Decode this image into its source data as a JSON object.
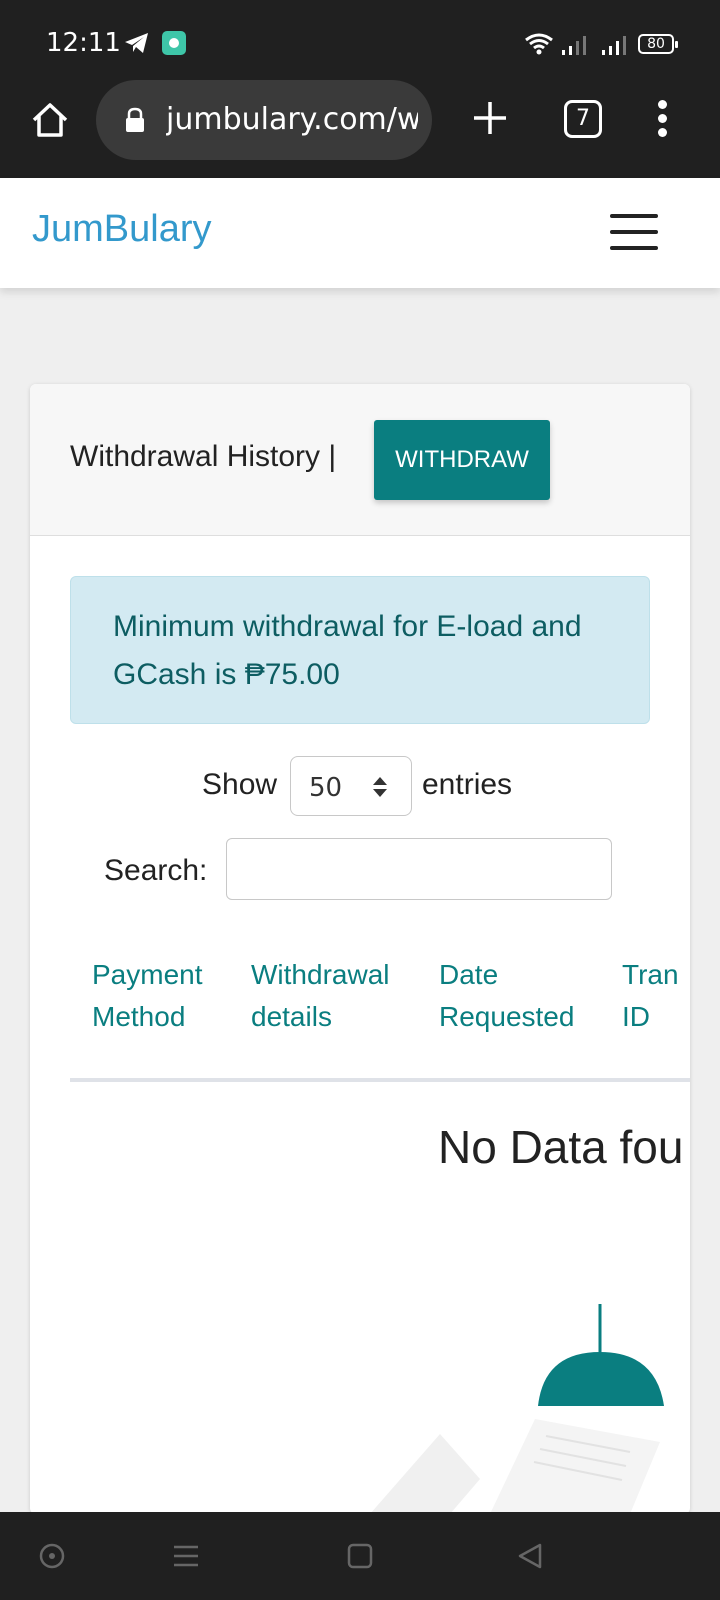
{
  "status_bar": {
    "time": "12:11",
    "battery": "80",
    "icons": [
      "telegram-icon",
      "app-notification-icon",
      "wifi-icon",
      "signal-icon",
      "signal-icon",
      "battery-icon"
    ]
  },
  "browser": {
    "url": "jumbulary.com/w",
    "tab_count": "7",
    "icons": [
      "home-icon",
      "lock-icon",
      "new-tab-icon",
      "more-icon"
    ]
  },
  "site": {
    "brand": "JumBulary",
    "menu_icon": "hamburger-icon"
  },
  "card": {
    "title": "Withdrawal History |",
    "withdraw_button": "WITHDRAW",
    "alert": "Minimum withdrawal for E-load and GCash is ₱75.00",
    "length": {
      "show_label": "Show",
      "selected": "50",
      "entries_label": "entries"
    },
    "search": {
      "label": "Search:",
      "value": "",
      "placeholder": ""
    },
    "table": {
      "headers": [
        "Payment\nMethod",
        "Withdrawal\ndetails",
        "Date\nRequested",
        "Tran\nID"
      ]
    },
    "empty_message": "No Data fou"
  },
  "colors": {
    "brand": "#3399cc",
    "accent": "#0a7e80",
    "alert_bg": "#d3eaf2",
    "alert_text": "#0d5d62"
  },
  "system_nav": {
    "icons": [
      "assistant-icon",
      "menu-icon",
      "home-square-icon",
      "back-icon"
    ]
  }
}
